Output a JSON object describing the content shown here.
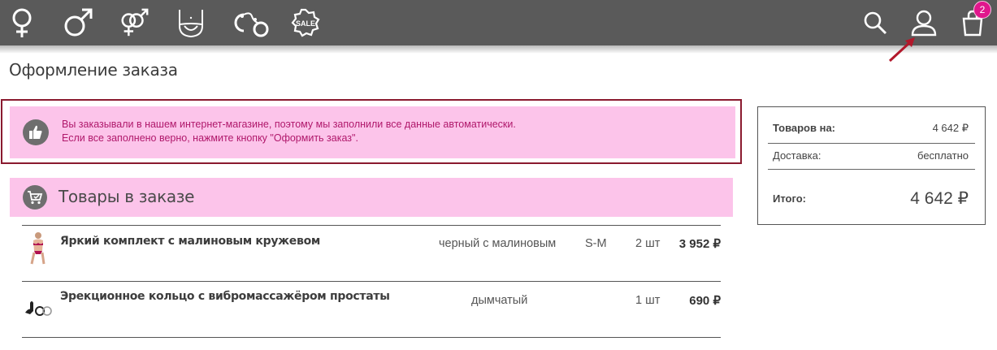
{
  "nav": {
    "icons": [
      "female-icon",
      "male-icon",
      "couple-icon",
      "lingerie-icon",
      "handcuffs-icon",
      "sale-icon"
    ],
    "sale_label": "SALE",
    "cart_count": "2"
  },
  "page": {
    "title": "Оформление заказа"
  },
  "notice": {
    "line1": "Вы заказывали в нашем интернет-магазине, поэтому мы заполнили все данные автоматически.",
    "line2": "Если все заполнено верно, нажмите кнопку \"Оформить заказ\"."
  },
  "section": {
    "title": "Товары в заказе"
  },
  "items": [
    {
      "name": "Яркий комплект с малиновым кружевом",
      "color": "черный с малиновым",
      "size": "S-M",
      "qty": "2 шт",
      "price": "3 952 ₽"
    },
    {
      "name": "Эрекционное кольцо с вибромассажёром простаты",
      "color": "дымчатый",
      "size": "",
      "qty": "1 шт",
      "price": "690 ₽"
    }
  ],
  "summary": {
    "goods_label": "Товаров на:",
    "goods_value": "4 642 ₽",
    "delivery_label": "Доставка:",
    "delivery_value": "бесплатно",
    "total_label": "Итого:",
    "total_value": "4 642 ₽"
  },
  "colors": {
    "topbar": "#5a5a5a",
    "pink": "#fcc4ea",
    "accent": "#e0168c",
    "annotation": "#b2182b"
  }
}
